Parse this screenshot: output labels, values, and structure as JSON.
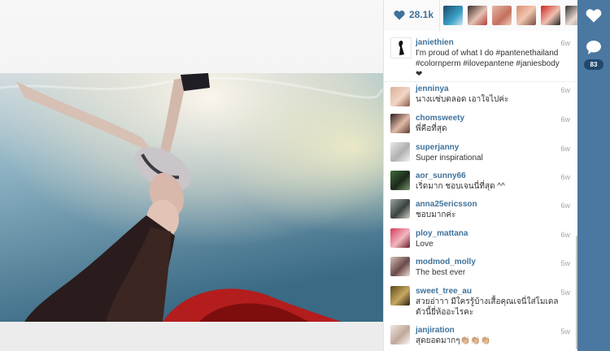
{
  "post": {
    "likes_count": "28.1k",
    "caption": {
      "username": "janiethien",
      "age": "6w",
      "text": "I'm proud of what I do #pantenethailand #colornperm #ilovepantene #janiesbody ❤"
    }
  },
  "comments": [
    {
      "username": "jenninya",
      "age": "6w",
      "text": "นางเเซ่บตลอด เอาใจไปค่ะ"
    },
    {
      "username": "chomsweety",
      "age": "6w",
      "text": "พี่คือที่สุด"
    },
    {
      "username": "superjanny",
      "age": "6w",
      "text": "Super inspirational"
    },
    {
      "username": "aor_sunny66",
      "age": "6w",
      "text": "เริ่ดมาก ชอบเจนนี่ที่สุด ^^"
    },
    {
      "username": "anna25ericsson",
      "age": "6w",
      "text": "ชอบมากค่ะ"
    },
    {
      "username": "ploy_mattana",
      "age": "6w",
      "text": "Love"
    },
    {
      "username": "modmod_molly",
      "age": "5w",
      "text": "The best ever"
    },
    {
      "username": "sweet_tree_au",
      "age": "5w",
      "text": "สวยอ่าาา มีใครรู้บ้างเสื้อคุณเจนี่ใส่โมเดลตัวนี้ยี่ห้ออะไรคะ"
    },
    {
      "username": "janjiration",
      "age": "5w",
      "text": "สุดยอดมากๆ👏🏼👏🏼👏🏼"
    }
  ],
  "rail": {
    "comment_count": "83"
  },
  "icons": {
    "like": "heart-icon",
    "rail_like": "heart-icon",
    "rail_comment": "speech-bubble-icon"
  },
  "colors": {
    "accent": "#3f729b",
    "rail": "#4b78a0"
  }
}
